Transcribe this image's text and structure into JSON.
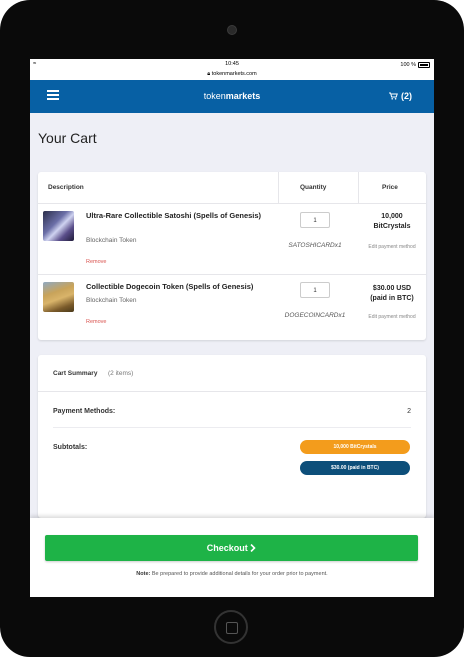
{
  "status_bar": {
    "time": "10:45",
    "battery": "100 %",
    "url": "tokenmarkets.com"
  },
  "navbar": {
    "brand_light": "token",
    "brand_bold": "markets",
    "cart_label": "(2)"
  },
  "page": {
    "title": "Your Cart"
  },
  "table": {
    "headers": [
      "Description",
      "Quantity",
      "Price"
    ],
    "items": [
      {
        "name": "Ultra-Rare Collectible Satoshi (Spells of Genesis)",
        "type": "Blockchain Token",
        "remove_label": "Remove",
        "quantity": "1",
        "code": "SATOSHICARDx1",
        "price_line1": "10,000",
        "price_line2": "BitCrystals",
        "edit_label": "Edit payment method",
        "thumb_icon": "satoshi-card-icon"
      },
      {
        "name": "Collectible Dogecoin Token (Spells of Genesis)",
        "type": "Blockchain Token",
        "remove_label": "Remove",
        "quantity": "1",
        "code": "DOGECOINCARDx1",
        "price_line1": "$30.00 USD",
        "price_line2": "(paid in BTC)",
        "edit_label": "Edit payment method",
        "thumb_icon": "dogecoin-card-icon"
      }
    ]
  },
  "summary": {
    "title": "Cart Summary",
    "count": "(2 items)",
    "payment_methods_label": "Payment Methods:",
    "payment_methods_value": "2",
    "subtotals_label": "Subtotals:",
    "subtotals": [
      "10,000 BitCrystals",
      "$30.00 (paid in BTC)"
    ]
  },
  "footer": {
    "checkout_label": "Checkout",
    "note_label": "Note:",
    "note_text": "Be prepared to provide additional details for your order prior to payment."
  },
  "colors": {
    "nav": "#0760a4",
    "checkout": "#1eb347",
    "pill_orange": "#f39c1c",
    "pill_navy": "#0d4f7a",
    "remove": "#d9534f"
  }
}
